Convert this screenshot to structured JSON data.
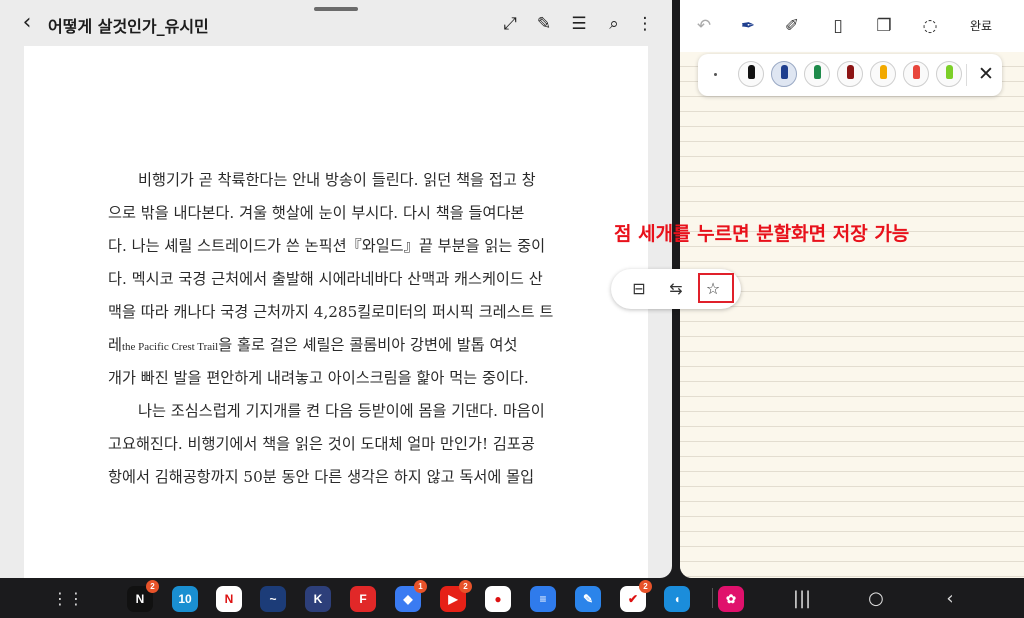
{
  "reader": {
    "title": "어떻게 살것인가_유시민",
    "icons": [
      "back-arrow-icon",
      "expand-icon",
      "edit-icon",
      "memo-icon",
      "search-icon",
      "more-icon"
    ],
    "page_lines": [
      "비행기가 곧 착륙한다는 안내 방송이 들린다. 읽던 책을 접고 창",
      "으로 밖을 내다본다. 겨울 햇살에 눈이 부시다. 다시 책을 들여다본",
      "다. 나는 셰릴 스트레이드가 쓴 논픽션『와일드』끝 부분을 읽는 중이",
      "다. 멕시코 국경 근처에서 출발해 시에라네바다 산맥과 캐스케이드 산",
      "맥을 따라 캐나다 국경 근처까지 4,285킬로미터의 퍼시픽 크레스트 트",
      "일을 홀로 걸은 셰릴은 콜롬비아 강변에 발톱 여섯",
      "개가 빠진 발을 편안하게 내려놓고 아이스크림을 핥아 먹는 중이다.",
      "나는 조심스럽게 기지개를 켠 다음 등받이에 몸을 기댄다. 마음이",
      "고요해진다. 비행기에서 책을 읽은 것이 도대체 얼마 만인가! 김포공",
      "항에서 김해공항까지 50분 동안 다른 생각은 하지 않고 독서에 몰입"
    ],
    "line6_prefix": "레",
    "line6_english": "the Pacific Crest Trail",
    "line6_suffix": "을 홀로 걸은 셰릴은 콜롬비아 강변에 발톱 여섯"
  },
  "split_toolbar": {
    "icons": [
      "split-view-icon",
      "swap-icon",
      "star-save-icon"
    ]
  },
  "annotation": "점 세개를 누르면 분할화면 저장 가능",
  "notes": {
    "done_label": "완료",
    "tools": [
      "undo-icon",
      "pen-icon",
      "highlighter-icon",
      "eraser-icon",
      "shapes-icon",
      "lasso-icon"
    ],
    "pen_colors": [
      "#111111",
      "#1f3f8f",
      "#1e8a4a",
      "#8c1414",
      "#f2a900",
      "#e8463c",
      "#7ccf28"
    ]
  },
  "taskbar": {
    "apps": [
      {
        "name": "netflix",
        "color": "#111111",
        "glyph": "N",
        "badge": "2"
      },
      {
        "name": "calendar",
        "color": "#1a8fd1",
        "glyph": "10",
        "badge": ""
      },
      {
        "name": "notion",
        "color": "#ffffff",
        "glyph": "N",
        "badge": ""
      },
      {
        "name": "waves",
        "color": "#1c3c78",
        "glyph": "~",
        "badge": ""
      },
      {
        "name": "kyobo-ebook",
        "color": "#2d3f7a",
        "glyph": "K",
        "badge": ""
      },
      {
        "name": "flipboard",
        "color": "#e12828",
        "glyph": "F",
        "badge": ""
      },
      {
        "name": "box-app",
        "color": "#3a7bf2",
        "glyph": "◆",
        "badge": "1"
      },
      {
        "name": "youtube",
        "color": "#e62117",
        "glyph": "▶",
        "badge": "2"
      },
      {
        "name": "youtube-music",
        "color": "#ffffff",
        "glyph": "●",
        "badge": ""
      },
      {
        "name": "docs",
        "color": "#2f7bec",
        "glyph": "≡",
        "badge": ""
      },
      {
        "name": "pen-app",
        "color": "#2b84ea",
        "glyph": "✎",
        "badge": ""
      },
      {
        "name": "todo",
        "color": "#ffffff",
        "glyph": "✔",
        "badge": "2"
      },
      {
        "name": "tutoring",
        "color": "#1b8ddb",
        "glyph": "◖",
        "badge": ""
      },
      {
        "name": "flower-app",
        "color": "#e0116c",
        "glyph": "✿",
        "badge": ""
      }
    ]
  }
}
